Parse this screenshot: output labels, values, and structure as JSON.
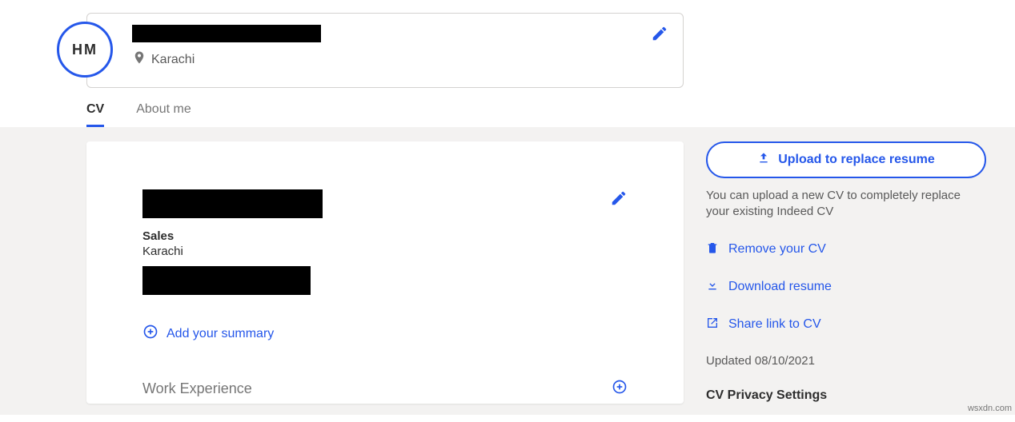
{
  "profile": {
    "initials": "HM",
    "location": "Karachi"
  },
  "tabs": {
    "cv": "CV",
    "about": "About me"
  },
  "cv": {
    "role": "Sales",
    "city": "Karachi",
    "add_summary": "Add your summary",
    "work_experience": "Work Experience"
  },
  "side": {
    "upload": "Upload to replace resume",
    "note": "You can upload a new CV to completely replace your existing Indeed CV",
    "remove": "Remove your CV",
    "download": "Download resume",
    "share": "Share link to CV",
    "updated_prefix": "Updated ",
    "updated_date": "08/10/2021",
    "privacy": "CV Privacy Settings"
  },
  "watermark": "wsxdn.com"
}
